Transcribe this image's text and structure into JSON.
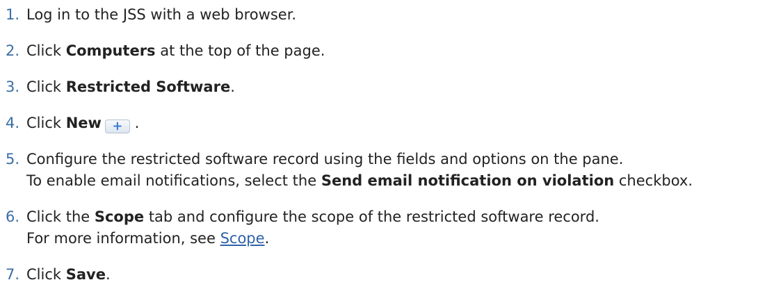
{
  "steps": [
    {
      "num": "1.",
      "text": "Log in to the JSS with a web browser."
    },
    {
      "num": "2.",
      "pre": "Click ",
      "bold": "Computers",
      "post": " at the top of the page."
    },
    {
      "num": "3.",
      "pre": "Click ",
      "bold": "Restricted Software",
      "post": "."
    },
    {
      "num": "4.",
      "pre": "Click ",
      "bold": "New",
      "icon_glyph": "+",
      "post": " ."
    },
    {
      "num": "5.",
      "line1": "Configure the restricted software record using the fields and options on the pane.",
      "line2_pre": "To enable email notifications, select the ",
      "line2_bold": "Send email notification on violation",
      "line2_post": " checkbox."
    },
    {
      "num": "6.",
      "pre": "Click the ",
      "bold": "Scope",
      "post": " tab and configure the scope of the restricted software record.",
      "line2_pre": "For more information, see ",
      "line2_link": "Scope",
      "line2_post": "."
    },
    {
      "num": "7.",
      "pre": "Click ",
      "bold": "Save",
      "post": "."
    }
  ],
  "colors": {
    "step_number": "#3a6ea5",
    "link": "#2f62a8",
    "text": "#222222"
  },
  "icons": {
    "new_button": "plus-icon"
  }
}
